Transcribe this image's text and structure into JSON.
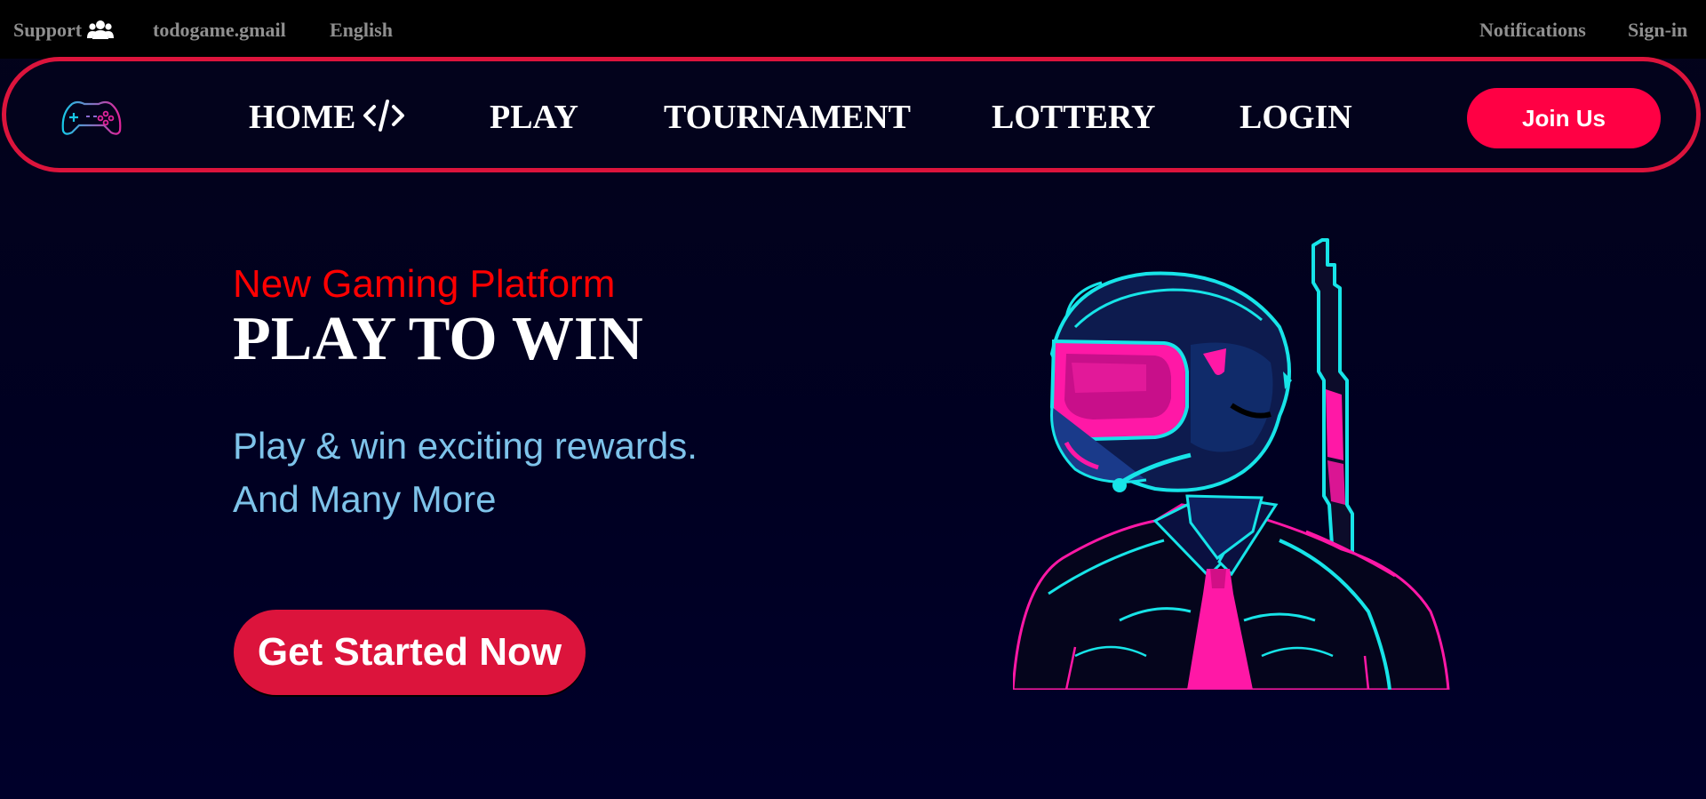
{
  "topbar": {
    "support": "Support",
    "support_icon": "users-icon",
    "email": "todogame.gmail",
    "language": "English",
    "notifications": "Notifications",
    "signin": "Sign-in"
  },
  "nav": {
    "logo_icon": "gamepad-icon",
    "items": [
      {
        "label": "HOME",
        "icon": "code-icon"
      },
      {
        "label": "PLAY"
      },
      {
        "label": "TOURNAMENT"
      },
      {
        "label": "LOTTERY"
      },
      {
        "label": "LOGIN"
      }
    ],
    "join_label": "Join Us"
  },
  "hero": {
    "eyebrow": "New Gaming Platform",
    "title": "PLAY TO WIN",
    "line1": "Play & win exciting rewards.",
    "line2": "And Many More",
    "cta": "Get Started Now",
    "illustration": "helmeted-soldier-with-rifle-illustration"
  },
  "colors": {
    "accent_red": "#dc143c",
    "join_pink": "#ff0044",
    "eyebrow_red": "#ff0000",
    "subtext_blue": "#7ec3ea",
    "neon_cyan": "#17e4e8",
    "neon_magenta": "#ff18a6",
    "background": "#000022"
  }
}
